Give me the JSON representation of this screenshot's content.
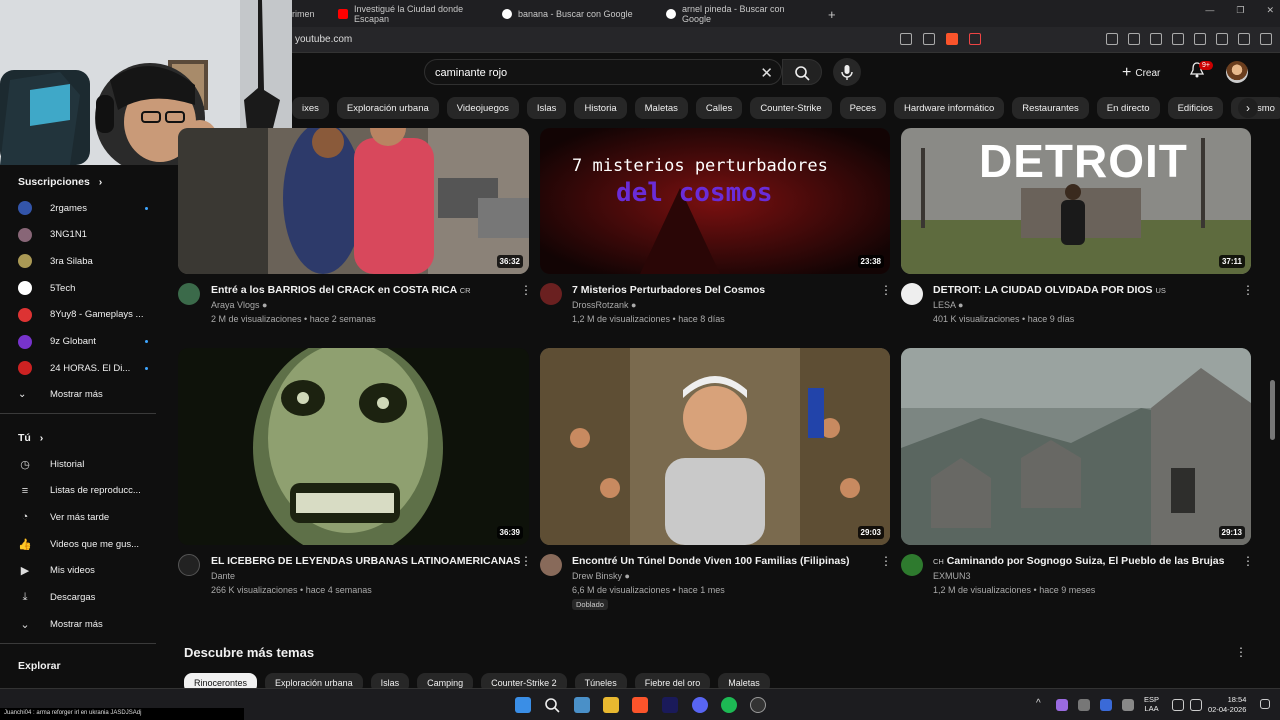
{
  "browser": {
    "tabs": [
      {
        "label": "rimen",
        "color": "#444"
      },
      {
        "label": "Investigué la Ciudad donde Escapan",
        "color": "#ff0000"
      },
      {
        "label": "banana - Buscar con Google",
        "color": "#4285f4"
      },
      {
        "label": "arnel pineda - Buscar con Google",
        "color": "#4285f4"
      }
    ],
    "new_tab": "+",
    "url": "youtube.com",
    "win_minimize": "—",
    "win_restore": "❐",
    "win_close": "✕"
  },
  "header": {
    "search_value": "caminante rojo",
    "clear_icon": "✕",
    "create_label": "Crear",
    "create_icon": "+",
    "notif_count": "9+"
  },
  "chips": [
    "ixes",
    "Exploración urbana",
    "Videojuegos",
    "Islas",
    "Historia",
    "Maletas",
    "Calles",
    "Counter-Strike",
    "Peces",
    "Hardware informático",
    "Restaurantes",
    "En directo",
    "Edificios",
    "Turismo",
    "A"
  ],
  "sidebar": {
    "subscriptions_title": "Suscripciones",
    "subscriptions": [
      {
        "label": "2rgames",
        "color": "#3355aa",
        "new": true
      },
      {
        "label": "3NG1N1",
        "color": "#886677",
        "new": false
      },
      {
        "label": "3ra Silaba",
        "color": "#aa9955",
        "new": false
      },
      {
        "label": "5Tech",
        "color": "#ffffff",
        "new": false
      },
      {
        "label": "8Yuy8 - Gameplays ...",
        "color": "#dd3333",
        "new": false
      },
      {
        "label": "9z Globant",
        "color": "#7733cc",
        "new": true
      },
      {
        "label": "24 HORAS. El Di...",
        "color": "#cc2222",
        "new": true
      }
    ],
    "show_more": "Mostrar más",
    "you_title": "Tú",
    "you_items": [
      "Historial",
      "Listas de reproducc...",
      "Ver más tarde",
      "Videos que me gus...",
      "Mis videos",
      "Descargas",
      "Mostrar más"
    ],
    "explore_title": "Explorar"
  },
  "videos": [
    {
      "title": "Entré a los BARRIOS del CRACK en COSTA RICA",
      "flag": "CR",
      "channel": "Araya Vlogs",
      "verified": true,
      "meta": "2 M de visualizaciones • hace 2 semanas",
      "duration": "36:32"
    },
    {
      "title": "7 Misterios Perturbadores Del Cosmos",
      "flag": "",
      "channel": "DrossRotzank",
      "verified": true,
      "meta": "1,2 M de visualizaciones • hace 8 días",
      "duration": "23:38",
      "thumb_text_1": "7 misterios perturbadores",
      "thumb_text_2": "del cosmos"
    },
    {
      "title": "DETROIT: LA CIUDAD OLVIDADA POR DIOS",
      "flag": "US",
      "channel": "LESA",
      "verified": true,
      "meta": "401 K visualizaciones • hace 9 días",
      "duration": "37:11",
      "thumb_text_1": "DETROIT"
    },
    {
      "title": "EL ICEBERG DE LEYENDAS URBANAS LATINOAMERICANAS",
      "flag": "",
      "channel": "Dante",
      "verified": false,
      "meta": "266 K visualizaciones • hace 4 semanas",
      "duration": "36:39"
    },
    {
      "title": "Encontré Un Túnel Donde Viven 100 Familias (Filipinas)",
      "flag": "",
      "channel": "Drew Binsky",
      "verified": true,
      "meta": "6,6 M de visualizaciones • hace 1 mes",
      "duration": "29:03",
      "badge": "Doblado"
    },
    {
      "title": "Caminando por Sognogo Suiza, El Pueblo de las Brujas",
      "flag": "CH",
      "channel": "EXMUN3",
      "verified": false,
      "meta": "1,2 M de visualizaciones • hace 9 meses",
      "duration": "29:13"
    }
  ],
  "topics": {
    "title": "Descubre más temas",
    "chips": [
      "Rinocerontes",
      "Exploración urbana",
      "Islas",
      "Camping",
      "Counter-Strike 2",
      "Túneles",
      "Fiebre del oro",
      "Maletas"
    ]
  },
  "taskbar": {
    "ticker": "Juanchi04 : arma reforger irl en ukrania JASDJSAdj",
    "lang_1": "ESP",
    "lang_2": "LAA",
    "time": "18:54",
    "date": "02-04-2026"
  },
  "colors": {
    "accent": "#3ea6ff",
    "yt_red": "#ff0000",
    "bg": "#0f0f0f"
  }
}
